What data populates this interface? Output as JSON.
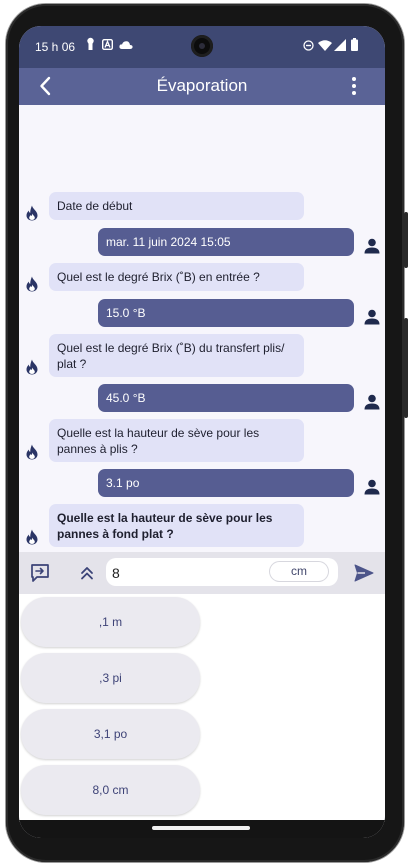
{
  "status_bar": {
    "time": "15 h 06",
    "icons": [
      "keyhole-icon",
      "a-badge-icon",
      "cloud-icon",
      "do-not-disturb-icon",
      "wifi-icon",
      "signal-icon",
      "battery-icon"
    ]
  },
  "app_bar": {
    "title": "Évaporation",
    "back_icon": "arrow-left-icon",
    "menu_icon": "more-vertical-icon"
  },
  "messages": [
    {
      "from": "bot",
      "text": "Date de début"
    },
    {
      "from": "user",
      "text": "mar. 11 juin 2024 15:05"
    },
    {
      "from": "bot",
      "text": "Quel est le degré Brix (˚B) en entrée ?"
    },
    {
      "from": "user",
      "text": "15.0 °B"
    },
    {
      "from": "bot",
      "text": "Quel est le degré Brix (˚B) du transfert plis/ plat ?"
    },
    {
      "from": "user",
      "text": "45.0 °B"
    },
    {
      "from": "bot",
      "text": "Quelle est la hauteur de sève pour les pannes à plis ?"
    },
    {
      "from": "user",
      "text": "3.1 po"
    },
    {
      "from": "bot",
      "text": "Quelle est la hauteur de sève pour les pannes à fond plat ?",
      "active": true
    }
  ],
  "input_bar": {
    "value": "8",
    "unit_label": "cm",
    "left_icon": "comment-arrow-icon",
    "expand_icon": "double-chevron-up-icon",
    "send_icon": "send-icon"
  },
  "suggestions": [
    ",1 m",
    ",3 pi",
    "3,1 po",
    "8,0 cm"
  ],
  "colors": {
    "status_bar": "#3e4873",
    "app_bar": "#5a6396",
    "user_bubble": "#565d92",
    "bot_bubble": "#e1e2f7",
    "bot_avatar": "#2b3566",
    "user_avatar": "#1f2a4d"
  }
}
